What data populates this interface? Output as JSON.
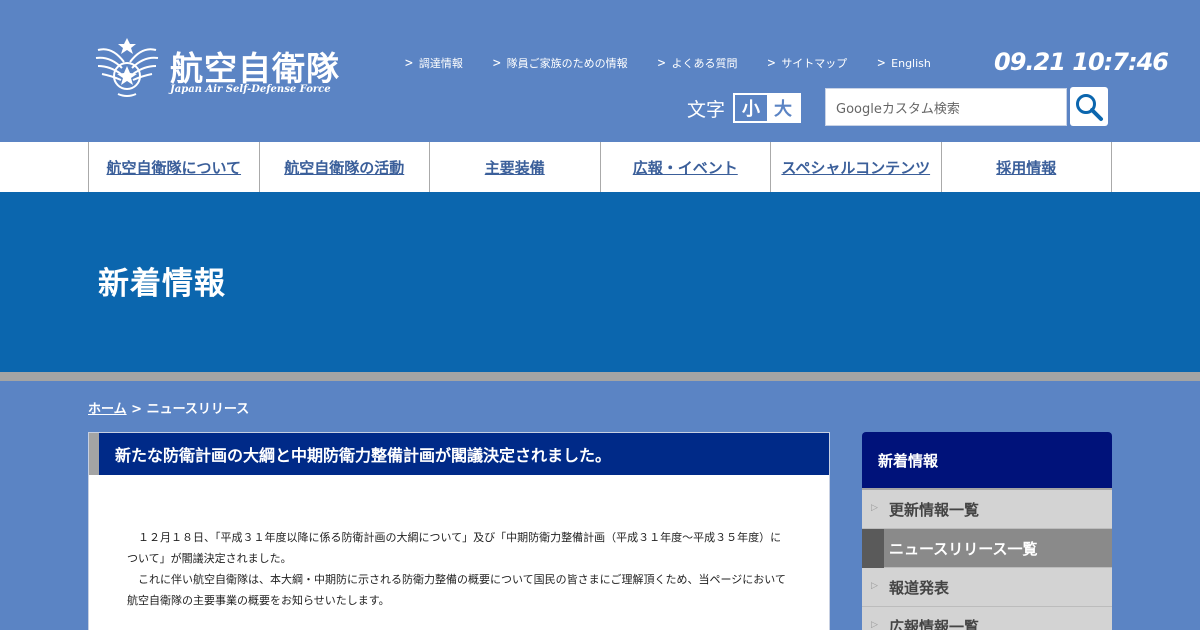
{
  "header": {
    "logo_title": "航空自衛隊",
    "logo_subtitle": "Japan Air Self-Defense Force",
    "utility_links": [
      {
        "label": "調達情報"
      },
      {
        "label": "隊員ご家族のための情報"
      },
      {
        "label": "よくある質問"
      },
      {
        "label": "サイトマップ"
      },
      {
        "label": "English"
      }
    ],
    "clock": "09.21 10:7:46",
    "font_size_label": "文字",
    "font_small": "小",
    "font_large": "大",
    "search_placeholder": "Googleカスタム検索"
  },
  "nav": {
    "items": [
      {
        "label": "航空自衛隊について"
      },
      {
        "label": "航空自衛隊の活動"
      },
      {
        "label": "主要装備"
      },
      {
        "label": "広報・イベント"
      },
      {
        "label": "スペシャルコンテンツ"
      },
      {
        "label": "採用情報"
      }
    ]
  },
  "hero": {
    "title": "新着情報"
  },
  "breadcrumb": {
    "home": "ホーム",
    "separator": " > ",
    "current": "ニュースリリース"
  },
  "article": {
    "title": "新たな防衛計画の大綱と中期防衛力整備計画が閣議決定されました。",
    "paragraphs": [
      "１２月１８日、「平成３１年度以降に係る防衛計画の大綱について」及び「中期防衛力整備計画（平成３１年度～平成３５年度）について」が閣議決定されました。",
      "これに伴い航空自衛隊は、本大綱・中期防に示される防衛力整備の概要について国民の皆さまにご理解頂くため、当ページにおいて航空自衛隊の主要事業の概要をお知らせいたします。"
    ]
  },
  "sidebar": {
    "title": "新着情報",
    "items": [
      {
        "label": "更新情報一覧"
      },
      {
        "label": "ニュースリリース一覧"
      },
      {
        "label": "報道発表"
      },
      {
        "label": "広報情報一覧"
      }
    ]
  },
  "colors": {
    "page_bg": "#5b84c4",
    "hero_bg": "#0b66ae",
    "article_header": "#002a88",
    "sidebar_header": "#00127a",
    "nav_text": "#3b5f9a"
  }
}
